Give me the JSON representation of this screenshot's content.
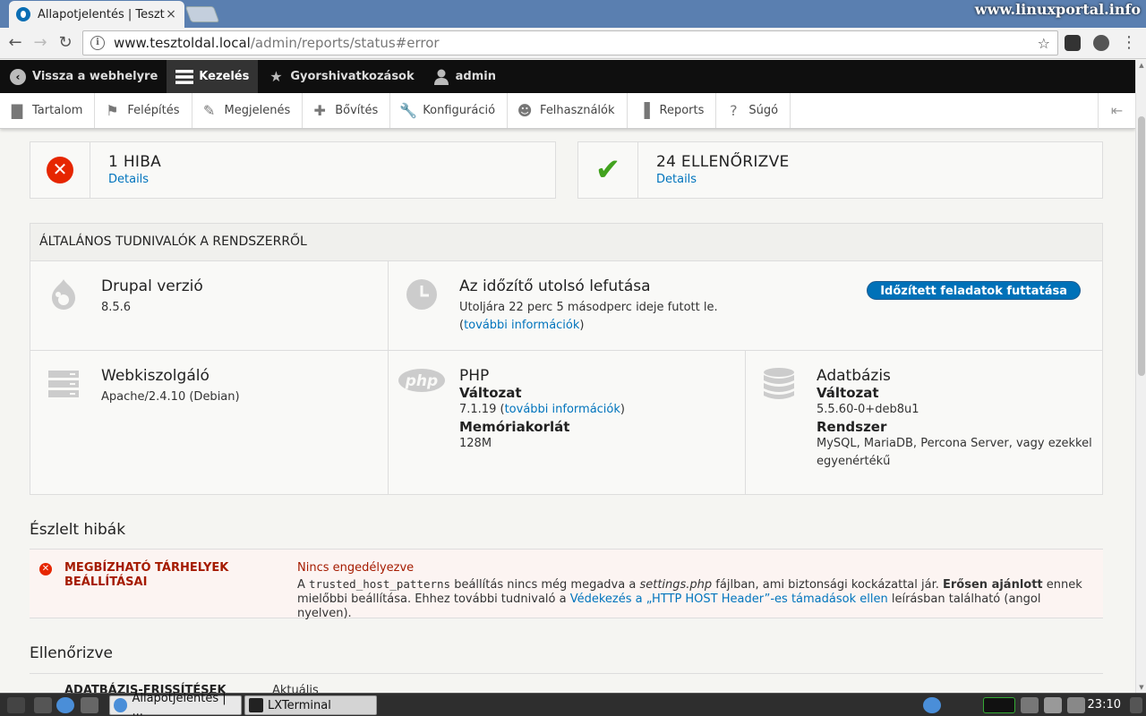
{
  "browser": {
    "tab_title": "Állapotjelentés | Teszt",
    "close_glyph": "×",
    "brand": "www.linuxportal.info",
    "url_host": "www.tesztoldal.local",
    "url_path": "/admin/reports/status#error",
    "info_glyph": "i",
    "back_glyph": "←",
    "forward_glyph": "→",
    "reload_glyph": "↻",
    "star_glyph": "☆"
  },
  "admin_bar": {
    "back_label": "Vissza a webhelyre",
    "manage_label": "Kezelés",
    "shortcuts_label": "Gyorshivatkozások",
    "user_label": "admin"
  },
  "tray": {
    "items": [
      {
        "label": "Tartalom",
        "icon": "▇"
      },
      {
        "label": "Felépítés",
        "icon": "⚑"
      },
      {
        "label": "Megjelenés",
        "icon": "✎"
      },
      {
        "label": "Bővítés",
        "icon": "✚"
      },
      {
        "label": "Konfiguráció",
        "icon": "🔧"
      },
      {
        "label": "Felhasználók",
        "icon": "☻"
      },
      {
        "label": "Reports",
        "icon": "▐"
      },
      {
        "label": "Súgó",
        "icon": "?"
      }
    ],
    "collapse_glyph": "⇤"
  },
  "counters": {
    "error_count": "1 HIBA",
    "error_link": "Details",
    "error_glyph": "✕",
    "ok_count": "24 ELLENŐRIZVE",
    "ok_link": "Details",
    "ok_glyph": "✔"
  },
  "general": {
    "heading": "ÁLTALÁNOS TUDNIVALÓK A RENDSZERRŐL",
    "drupal_title": "Drupal verzió",
    "drupal_version": "8.5.6",
    "cron_title": "Az időzítő utolsó lefutása",
    "cron_text": "Utoljára 22 perc 5 másodperc ideje futott le.",
    "cron_more_open": "(",
    "cron_more_link": "további információk",
    "cron_more_close": ")",
    "cron_button": "Időzített feladatok futtatása",
    "web_title": "Webkiszolgáló",
    "web_value": "Apache/2.4.10 (Debian)",
    "php_title": "PHP",
    "php_logo": "php",
    "php_version_label": "Változat",
    "php_version": "7.1.19",
    "php_more_open": " (",
    "php_more_link": "további információk",
    "php_more_close": ")",
    "php_memory_label": "Memóriakorlát",
    "php_memory": "128M",
    "db_title": "Adatbázis",
    "db_version_label": "Változat",
    "db_version": "5.5.60-0+deb8u1",
    "db_system_label": "Rendszer",
    "db_system": "MySQL, MariaDB, Percona Server, vagy ezekkel egyenértékű"
  },
  "errors": {
    "heading": "Észlelt hibák",
    "item_glyph": "✕",
    "item_name": "MEGBÍZHATÓ TÁRHELYEK BEÁLLÍTÁSAI",
    "item_status": "Nincs engedélyezve",
    "desc_1": "A ",
    "desc_code": "trusted_host_patterns",
    "desc_2": " beállítás nincs még megadva a ",
    "desc_file": "settings.php",
    "desc_3": " fájlban, ami biztonsági kockázattal jár. ",
    "desc_strong": "Erősen ajánlott",
    "desc_4": " ennek mielőbbi beállítása. Ehhez további tudnivaló a ",
    "desc_link": "Védekezés a „HTTP HOST Header”-es támadások ellen",
    "desc_5": " leírásban található (angol nyelven)."
  },
  "checked": {
    "heading": "Ellenőrizve",
    "item_name": "ADATBÁZIS-FRISSÍTÉSEK",
    "item_status": "Aktuális"
  },
  "taskbar": {
    "task1": "Állapotjelentés | ...",
    "task2": "LXTerminal",
    "clock": "23:10"
  },
  "colors": {
    "error": "#e62600",
    "ok": "#42a21e",
    "link": "#0074bd",
    "admin_bar": "#0f0f0f"
  }
}
